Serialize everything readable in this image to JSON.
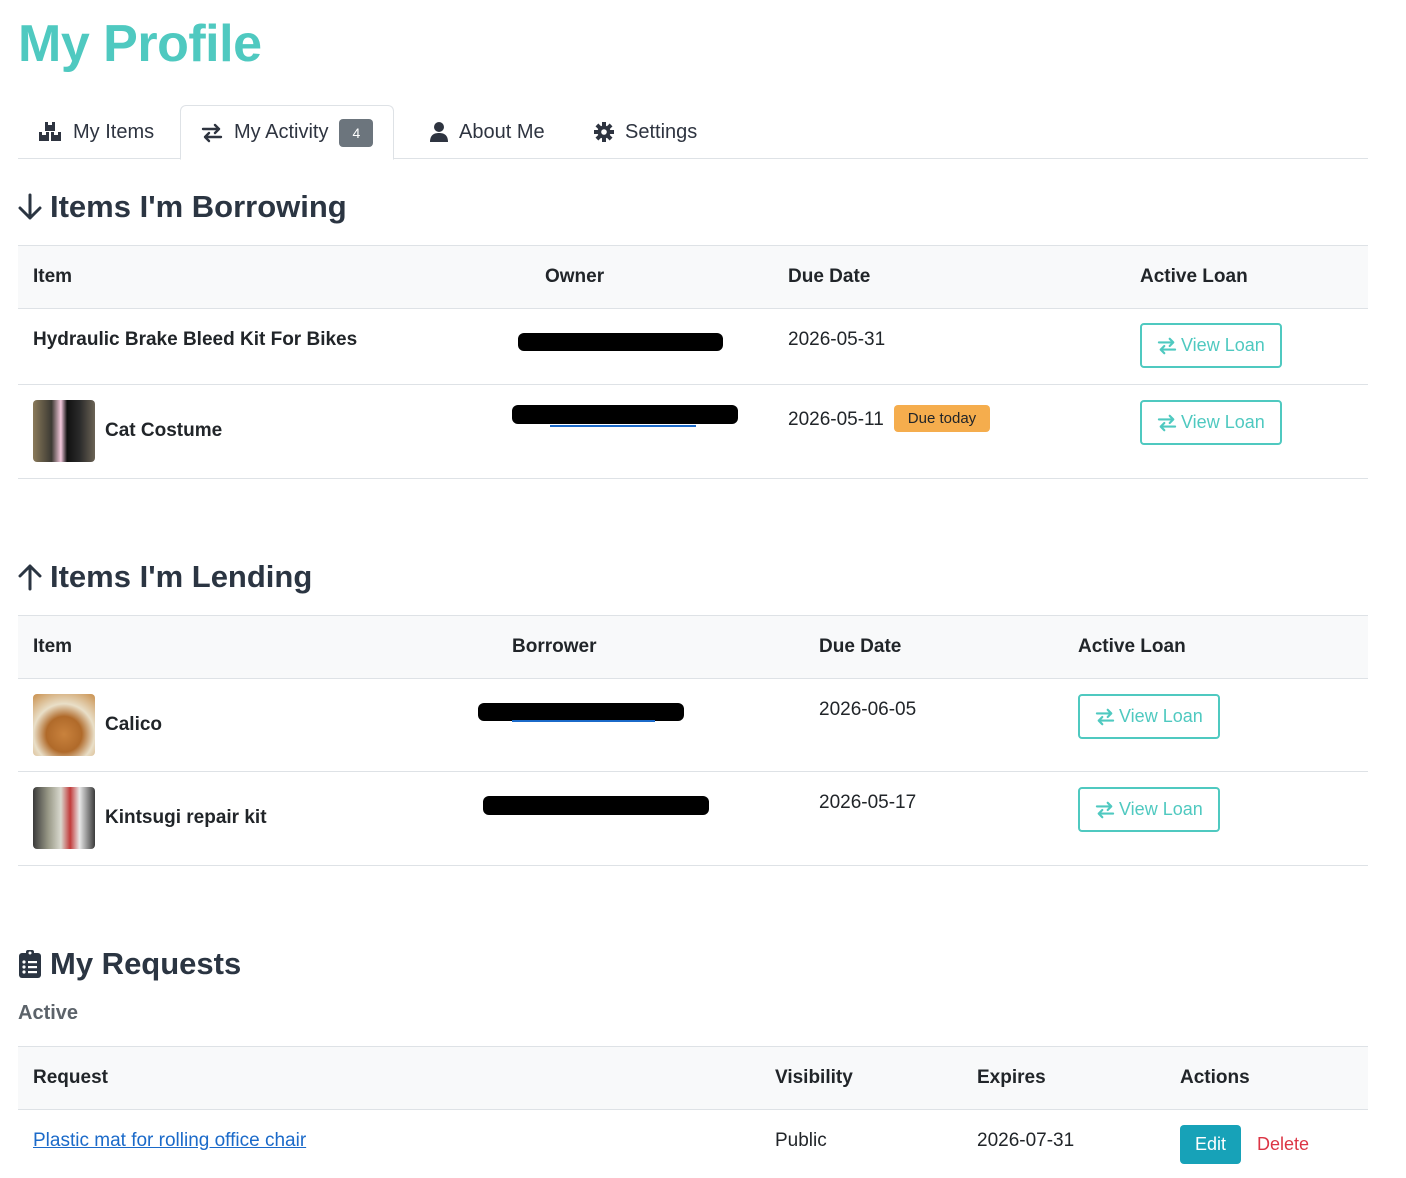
{
  "page_title": "My Profile",
  "tabs": [
    {
      "label": "My Items",
      "icon": "boxes-icon"
    },
    {
      "label": "My Activity",
      "icon": "exchange-icon",
      "badge": "4"
    },
    {
      "label": "About Me",
      "icon": "user-icon"
    },
    {
      "label": "Settings",
      "icon": "gear-icon"
    }
  ],
  "borrowing": {
    "title": "Items I'm Borrowing",
    "icon": "arrow-down-icon",
    "columns": [
      "Item",
      "Owner",
      "Due Date",
      "Active Loan"
    ],
    "rows": [
      {
        "item": "Hydraulic Brake Bleed Kit For Bikes",
        "due_date": "2026-05-31",
        "action": "View Loan"
      },
      {
        "item": "Cat Costume",
        "due_date": "2026-05-11",
        "badge": "Due today",
        "action": "View Loan"
      }
    ]
  },
  "lending": {
    "title": "Items I'm Lending",
    "icon": "arrow-up-icon",
    "columns": [
      "Item",
      "Borrower",
      "Due Date",
      "Active Loan"
    ],
    "rows": [
      {
        "item": "Calico",
        "due_date": "2026-06-05",
        "action": "View Loan"
      },
      {
        "item": "Kintsugi repair kit",
        "due_date": "2026-05-17",
        "action": "View Loan"
      }
    ]
  },
  "requests": {
    "title": "My Requests",
    "icon": "clipboard-list-icon",
    "subtitle": "Active",
    "columns": [
      "Request",
      "Visibility",
      "Expires",
      "Actions"
    ],
    "rows": [
      {
        "request": "Plastic mat for rolling office chair",
        "visibility": "Public",
        "expires": "2026-07-31",
        "edit": "Edit",
        "delete": "Delete"
      }
    ]
  },
  "colors": {
    "brand": "#4fc9c0",
    "link": "#1b6ac9",
    "warning": "#f5ad4d",
    "danger": "#dc3545",
    "info": "#17a2b8"
  }
}
